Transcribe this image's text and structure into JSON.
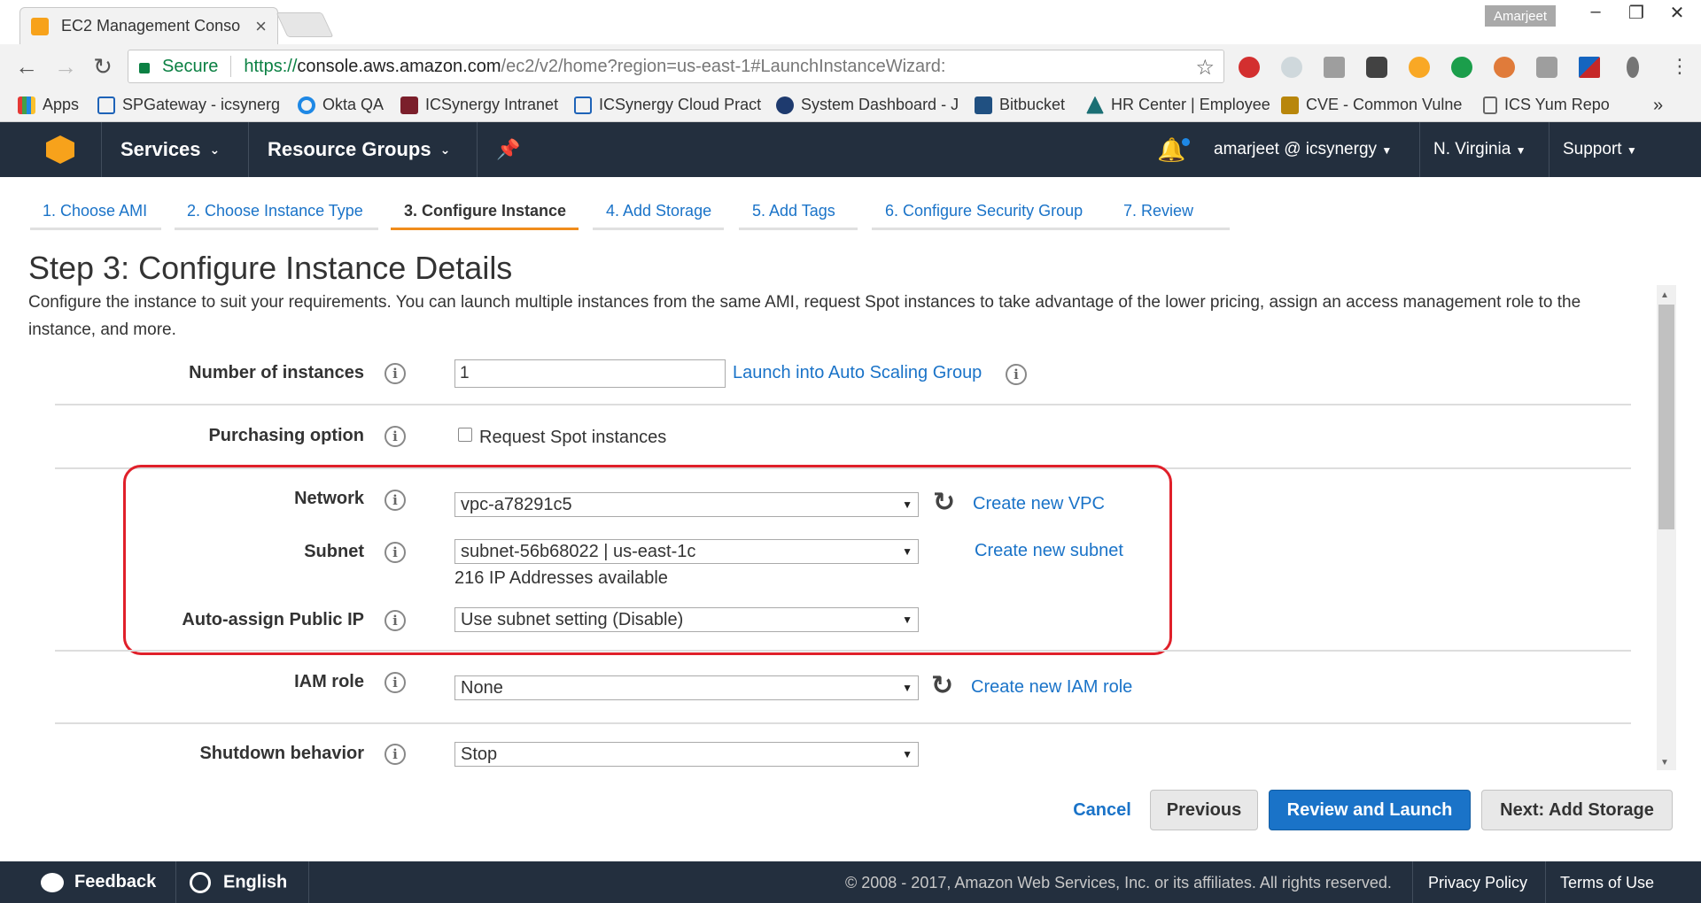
{
  "browser": {
    "tab_title": "EC2 Management Conso",
    "tab_close": "×",
    "profile_name": "Amarjeet",
    "window": {
      "minimize": "–",
      "maximize": "❐",
      "close": "✕"
    },
    "secure_label": "Secure",
    "url_proto": "https://",
    "url_host": "console.aws.amazon.com",
    "url_path": "/ec2/v2/home?region=us-east-1#LaunchInstanceWizard:",
    "bookmarks": [
      "Apps",
      "SPGateway - icsynerg",
      "Okta QA",
      "ICSynergy Intranet",
      "ICSynergy Cloud Pract",
      "System Dashboard - J",
      "Bitbucket",
      "HR Center | Employee",
      "CVE - Common Vulne",
      "ICS Yum Repo"
    ],
    "bookmarks_more": "»"
  },
  "aws": {
    "services": "Services",
    "resource_groups": "Resource Groups",
    "user": "amarjeet @ icsynergy",
    "region": "N. Virginia",
    "support": "Support"
  },
  "wizard": {
    "tabs": [
      "1. Choose AMI",
      "2. Choose Instance Type",
      "3. Configure Instance",
      "4. Add Storage",
      "5. Add Tags",
      "6. Configure Security Group",
      "7. Review"
    ],
    "active_tab": 2,
    "title": "Step 3: Configure Instance Details",
    "description": "Configure the instance to suit your requirements. You can launch multiple instances from the same AMI, request Spot instances to take advantage of the lower pricing, assign an access management role to the instance, and more."
  },
  "form": {
    "num_instances_label": "Number of instances",
    "num_instances_value": "1",
    "auto_scaling_link": "Launch into Auto Scaling Group",
    "purchasing_label": "Purchasing option",
    "spot_label": "Request Spot instances",
    "network_label": "Network",
    "network_value": "vpc-a78291c5",
    "create_vpc": "Create new VPC",
    "subnet_label": "Subnet",
    "subnet_value": "subnet-56b68022 | us-east-1c",
    "create_subnet": "Create new subnet",
    "ip_available": "216 IP Addresses available",
    "public_ip_label": "Auto-assign Public IP",
    "public_ip_value": "Use subnet setting (Disable)",
    "iam_label": "IAM role",
    "iam_value": "None",
    "create_iam": "Create new IAM role",
    "shutdown_label": "Shutdown behavior",
    "shutdown_value": "Stop"
  },
  "buttons": {
    "cancel": "Cancel",
    "previous": "Previous",
    "review_launch": "Review and Launch",
    "next": "Next: Add Storage"
  },
  "footer": {
    "feedback": "Feedback",
    "language": "English",
    "copyright": "© 2008 - 2017, Amazon Web Services, Inc. or its affiliates. All rights reserved.",
    "privacy": "Privacy Policy",
    "terms": "Terms of Use"
  }
}
